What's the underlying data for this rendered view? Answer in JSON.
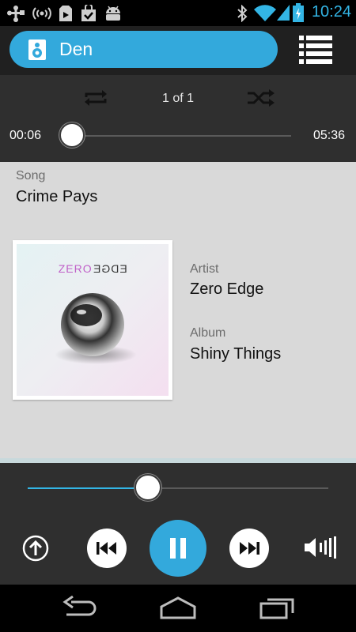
{
  "status_bar": {
    "time": "10:24",
    "icons": [
      "usb-icon",
      "wireless-hotspot-icon",
      "play-store-icon",
      "shopping-bag-icon",
      "android-icon",
      "bluetooth-icon",
      "wifi-icon",
      "signal-icon",
      "battery-charging-icon"
    ],
    "accent": "#33b5e5"
  },
  "header": {
    "zone_name": "Den",
    "zone_color": "#33a9dc"
  },
  "playback": {
    "track_count": "1 of 1",
    "elapsed": "00:06",
    "duration": "05:36",
    "progress_fraction": 0.02
  },
  "track": {
    "song_label": "Song",
    "song": "Crime Pays",
    "artist_label": "Artist",
    "artist": "Zero Edge",
    "album_label": "Album",
    "album": "Shiny Things",
    "album_art_text_left": "ZERO",
    "album_art_text_right": "EDGE"
  },
  "volume": {
    "level_fraction": 0.4,
    "fill_color": "#33b5e5"
  },
  "transport": {
    "icons": [
      "upload-icon",
      "previous-icon",
      "pause-icon",
      "next-icon",
      "volume-icon"
    ],
    "pause_color": "#33a9dc"
  },
  "navbar": {
    "icons": [
      "back-icon",
      "home-icon",
      "recent-apps-icon"
    ]
  }
}
